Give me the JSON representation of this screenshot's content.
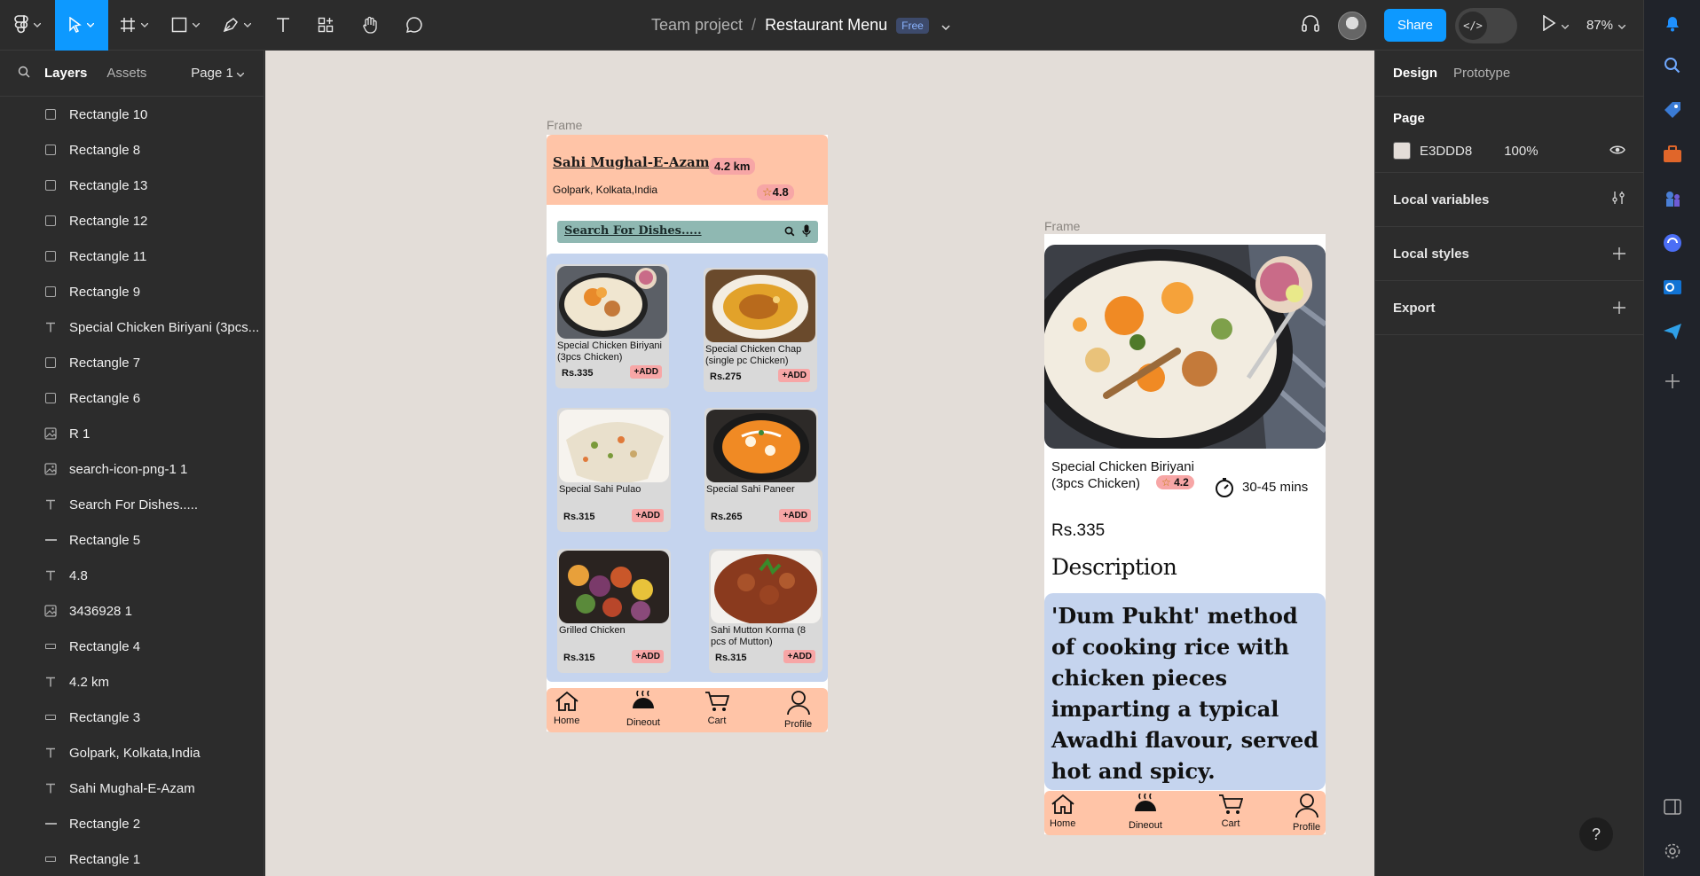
{
  "toolbar": {
    "breadcrumb_team": "Team project",
    "breadcrumb_sep": "/",
    "file_name": "Restaurant Menu",
    "plan_badge": "Free",
    "share_label": "Share",
    "dev_mode_label": "</>",
    "zoom": "87%"
  },
  "left_panel": {
    "tab_layers": "Layers",
    "tab_assets": "Assets",
    "page_selector": "Page 1",
    "layers": [
      {
        "name": "Rectangle 10",
        "icon": "rect"
      },
      {
        "name": "Rectangle 8",
        "icon": "rect"
      },
      {
        "name": "Rectangle 13",
        "icon": "rect"
      },
      {
        "name": "Rectangle 12",
        "icon": "rect"
      },
      {
        "name": "Rectangle 11",
        "icon": "rect"
      },
      {
        "name": "Rectangle 9",
        "icon": "rect"
      },
      {
        "name": "Special Chicken Biriyani (3pcs...",
        "icon": "text"
      },
      {
        "name": "Rectangle 7",
        "icon": "rect"
      },
      {
        "name": "Rectangle 6",
        "icon": "rect"
      },
      {
        "name": "R 1",
        "icon": "image"
      },
      {
        "name": "search-icon-png-1 1",
        "icon": "image"
      },
      {
        "name": "Search For Dishes.....",
        "icon": "text"
      },
      {
        "name": "Rectangle 5",
        "icon": "dash"
      },
      {
        "name": "4.8",
        "icon": "text"
      },
      {
        "name": "3436928 1",
        "icon": "image"
      },
      {
        "name": "Rectangle 4",
        "icon": "line"
      },
      {
        "name": "4.2 km",
        "icon": "text"
      },
      {
        "name": "Rectangle 3",
        "icon": "line"
      },
      {
        "name": "Golpark, Kolkata,India",
        "icon": "text"
      },
      {
        "name": "Sahi Mughal-E-Azam",
        "icon": "text"
      },
      {
        "name": "Rectangle 2",
        "icon": "dash"
      },
      {
        "name": "Rectangle 1",
        "icon": "line"
      }
    ]
  },
  "canvas": {
    "background": "#E3DDD8",
    "frame1_label": "Frame",
    "frame2_label": "Frame"
  },
  "menu_frame": {
    "restaurant_name": "Sahi Mughal-E-Azam",
    "distance": "4.2 km",
    "location": "Golpark, Kolkata,India",
    "rating": "4.8",
    "search_placeholder": "Search For Dishes.....",
    "dishes": [
      {
        "name": "Special Chicken Biriyani (3pcs Chicken)",
        "price": "Rs.335",
        "add": "+ADD",
        "img": "biriyani"
      },
      {
        "name": "Special Chicken Chap (single pc Chicken)",
        "price": "Rs.275",
        "add": "+ADD",
        "img": "chap"
      },
      {
        "name": "Special Sahi Pulao",
        "price": "Rs.315",
        "add": "+ADD",
        "img": "pulao"
      },
      {
        "name": "Special Sahi Paneer",
        "price": "Rs.265",
        "add": "+ADD",
        "img": "paneer"
      },
      {
        "name": "Grilled Chicken",
        "price": "Rs.315",
        "add": "+ADD",
        "img": "grilled"
      },
      {
        "name": "Sahi Mutton Korma (8 pcs of Mutton)",
        "price": "Rs.315",
        "add": "+ADD",
        "img": "korma"
      }
    ],
    "nav": [
      "Home",
      "Dineout",
      "Cart",
      "Profile"
    ]
  },
  "detail_frame": {
    "dish_name": "Special Chicken Biriyani (3pcs Chicken)",
    "rating": "4.2",
    "time": "30-45 mins",
    "price": "Rs.335",
    "description_title": "Description",
    "description": "'Dum Pukht' method of cooking rice with chicken pieces imparting a typical Awadhi flavour, served hot and spicy.",
    "nav": [
      "Home",
      "Dineout",
      "Cart",
      "Profile"
    ]
  },
  "right_panel": {
    "tab_design": "Design",
    "tab_prototype": "Prototype",
    "page_title": "Page",
    "page_fill_hex": "E3DDD8",
    "page_fill_opacity": "100%",
    "local_variables": "Local variables",
    "local_styles": "Local styles",
    "export": "Export"
  },
  "colors": {
    "accent": "#0D99FF",
    "peach": "#FFC4A7",
    "light_blue": "#C5D4EE",
    "pink_badge": "#F7A6A6",
    "search_teal": "#8FB8B2"
  },
  "help": "?"
}
